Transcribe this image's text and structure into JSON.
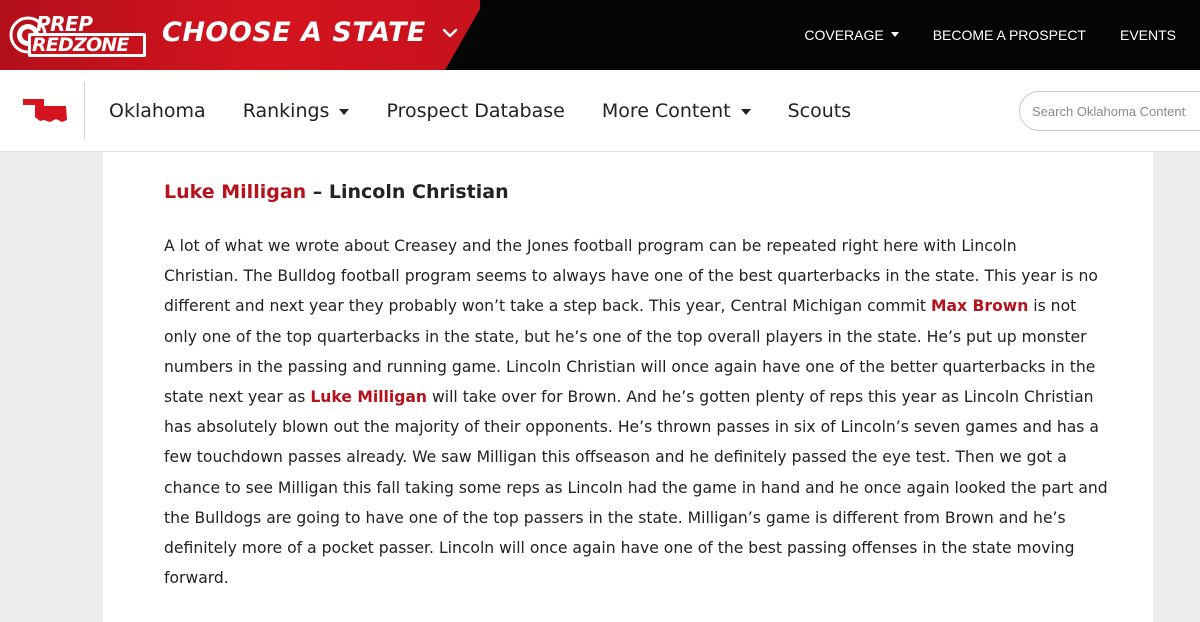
{
  "brand": {
    "logo_line1": "PREP",
    "logo_line2": "REDZONE",
    "state_chooser": "CHOOSE A STATE"
  },
  "top_nav": [
    {
      "label": "COVERAGE",
      "dropdown": true
    },
    {
      "label": "BECOME A PROSPECT",
      "dropdown": false
    },
    {
      "label": "EVENTS",
      "dropdown": false
    }
  ],
  "state_nav": [
    {
      "label": "Oklahoma",
      "dropdown": false
    },
    {
      "label": "Rankings",
      "dropdown": true
    },
    {
      "label": "Prospect Database",
      "dropdown": false
    },
    {
      "label": "More Content",
      "dropdown": true
    },
    {
      "label": "Scouts",
      "dropdown": false
    }
  ],
  "search": {
    "placeholder": "Search Oklahoma Content"
  },
  "article": {
    "player_name": "Luke Milligan",
    "heading_rest": " – Lincoln Christian",
    "lines": [
      [
        "A lot of what we wrote about Creasey and the Jones football program can be repeated right here with Lincoln"
      ],
      [
        "Christian. The Bulldog football program seems to always have one of the best quarterbacks in the state. This year is no"
      ],
      [
        "different and next year they probably won’t take a step back. This year, Central Michigan commit ",
        {
          "link": "Max Brown"
        },
        " is not"
      ],
      [
        "only one of the top quarterbacks in the state, but he’s one of the top overall players in the state. He’s put up monster"
      ],
      [
        "numbers in the passing and running game. Lincoln Christian will once again have one of the better quarterbacks in the"
      ],
      [
        "state next year as ",
        {
          "link": "Luke Milligan"
        },
        " will take over for Brown. And he’s gotten plenty of reps this year as Lincoln Christian"
      ],
      [
        "has absolutely blown out the majority of their opponents. He’s thrown passes in six of Lincoln’s seven games and has a"
      ],
      [
        "few touchdown passes already. We saw Milligan this offseason and he definitely passed the eye test. Then we got a"
      ],
      [
        "chance to see Milligan this fall taking some reps as Lincoln had the game in hand and he once again looked the part and"
      ],
      [
        "the Bulldogs are going to have one of the top passers in the state. Milligan’s game is different from Brown and he’s"
      ],
      [
        "definitely more of a pocket passer. Lincoln will once again have one of the best passing offenses in the state moving"
      ],
      [
        "forward."
      ]
    ]
  },
  "colors": {
    "brand_red": "#d4141f",
    "link_red": "#b5121b",
    "topbar_bg": "#050505"
  },
  "icons": [
    "chevron-down-icon",
    "oklahoma-state-icon",
    "caret-down-icon"
  ]
}
